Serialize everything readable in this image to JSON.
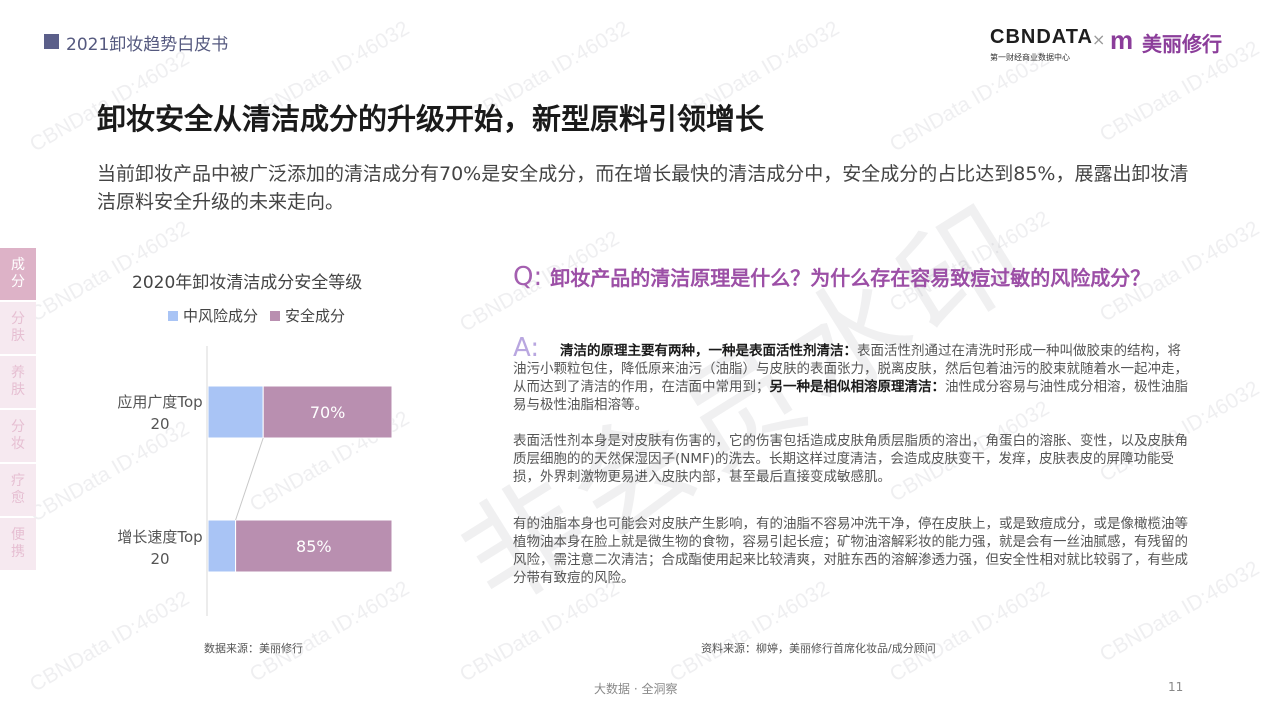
{
  "header": {
    "title": "2021卸妆趋势白皮书"
  },
  "logos": {
    "cbn_text": "CBNDATA",
    "cbn_sub": "第一财经商业数据中心",
    "times": "×",
    "brand_mark": "m",
    "brand_text": "美丽修行"
  },
  "main": {
    "title": "卸妆安全从清洁成分的升级开始，新型原料引领增长",
    "intro": "当前卸妆产品中被广泛添加的清洁成分有70%是安全成分，而在增长最快的清洁成分中，安全成分的占比达到85%，展露出卸妆清洁原料安全升级的未来走向。"
  },
  "side_tabs": [
    {
      "label": "成分",
      "active": true
    },
    {
      "label": "分肤",
      "active": false
    },
    {
      "label": "养肤",
      "active": false
    },
    {
      "label": "分妆",
      "active": false
    },
    {
      "label": "疗愈",
      "active": false
    },
    {
      "label": "便携",
      "active": false
    }
  ],
  "chart_data": {
    "type": "bar",
    "orientation": "horizontal",
    "stacked": true,
    "title": "2020年卸妆清洁成分安全等级",
    "categories": [
      "应用广度Top 20",
      "增长速度Top 20"
    ],
    "series": [
      {
        "name": "中风险成分",
        "values": [
          30,
          15
        ],
        "color": "#a9c4f5"
      },
      {
        "name": "安全成分",
        "values": [
          70,
          85
        ],
        "color": "#b98fb0"
      }
    ],
    "data_labels": [
      "70%",
      "85%"
    ],
    "xlim": [
      0,
      100
    ],
    "legend_position": "top"
  },
  "chart_labels": {
    "cat1_line1": "应用广度Top",
    "cat1_line2": "20",
    "cat2_line1": "增长速度Top",
    "cat2_line2": "20"
  },
  "sources": {
    "left": "数据来源：美丽修行",
    "right": "资料来源：柳婷，美丽修行首席化妆品/成分顾问"
  },
  "qa": {
    "q_mark": "Q:",
    "question": "卸妆产品的清洁原理是什么？为什么存在容易致痘过敏的风险成分？",
    "a_mark": "A:",
    "p1_bold1": "清洁的原理主要有两种，一种是表面活性剂清洁：",
    "p1_text1": "表面活性剂通过在清洗时形成一种叫做胶束的结构，将油污小颗粒包住，降低原来油污（油脂）与皮肤的表面张力，脱离皮肤，然后包着油污的胶束就随着水一起冲走，从而达到了清洁的作用，在洁面中常用到；",
    "p1_bold2": "另一种是相似相溶原理清洁：",
    "p1_text2": "油性成分容易与油性成分相溶，极性油脂易与极性油脂相溶等。",
    "p2": "表面活性剂本身是对皮肤有伤害的，它的伤害包括造成皮肤角质层脂质的溶出，角蛋白的溶胀、变性，以及皮肤角质层细胞的的天然保湿因子(NMF)的洗去。长期这样过度清洁，会造成皮肤变干，发痒，皮肤表皮的屏障功能受损，外界刺激物更易进入皮肤内部，甚至最后直接变成敏感肌。",
    "p3": "有的油脂本身也可能会对皮肤产生影响，有的油脂不容易冲洗干净，停在皮肤上，或是致痘成分，或是像橄榄油等植物油本身在脸上就是微生物的食物，容易引起长痘；矿物油溶解彩妆的能力强，就是会有一丝油腻感，有残留的风险，需注意二次清洁；合成酯使用起来比较清爽，对脏东西的溶解渗透力强，但安全性相对就比较弱了，有些成分带有致痘的风险。"
  },
  "footer": {
    "text": "大数据 · 全洞察",
    "page": "11"
  },
  "watermark": {
    "text": "CBNData ID:46032",
    "stamp": "非会员水印"
  }
}
